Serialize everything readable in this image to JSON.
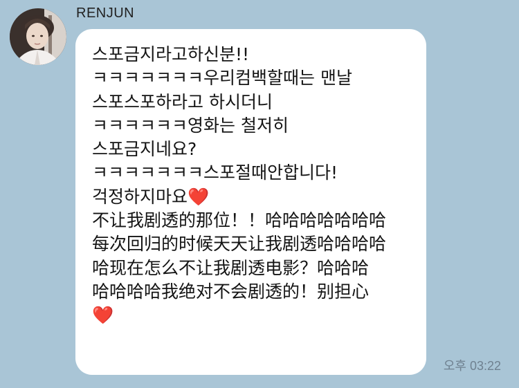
{
  "sender": {
    "name": "RENJUN"
  },
  "message": {
    "lines": [
      "스포금지라고하신분!!",
      "ㅋㅋㅋㅋㅋㅋㅋ우리컴백할때는 맨날",
      "스포스포하라고 하시더니",
      "ㅋㅋㅋㅋㅋㅋ영화는 철저히",
      "스포금지네요?",
      "ㅋㅋㅋㅋㅋㅋㅋ스포절때안합니다!",
      "걱정하지마요❤️",
      "不让我剧透的那位！！哈哈哈哈哈哈哈",
      "每次回归的时候天天让我剧透哈哈哈哈",
      "哈现在怎么不让我剧透电影？哈哈哈",
      "哈哈哈哈我绝对不会剧透的！别担心",
      "❤️"
    ]
  },
  "timestamp": "오후 03:22",
  "icons": {
    "avatar": "profile-photo"
  },
  "colors": {
    "background": "#a9c5d6",
    "bubble": "#ffffff",
    "text": "#141414",
    "timestamp": "#6f8190"
  }
}
